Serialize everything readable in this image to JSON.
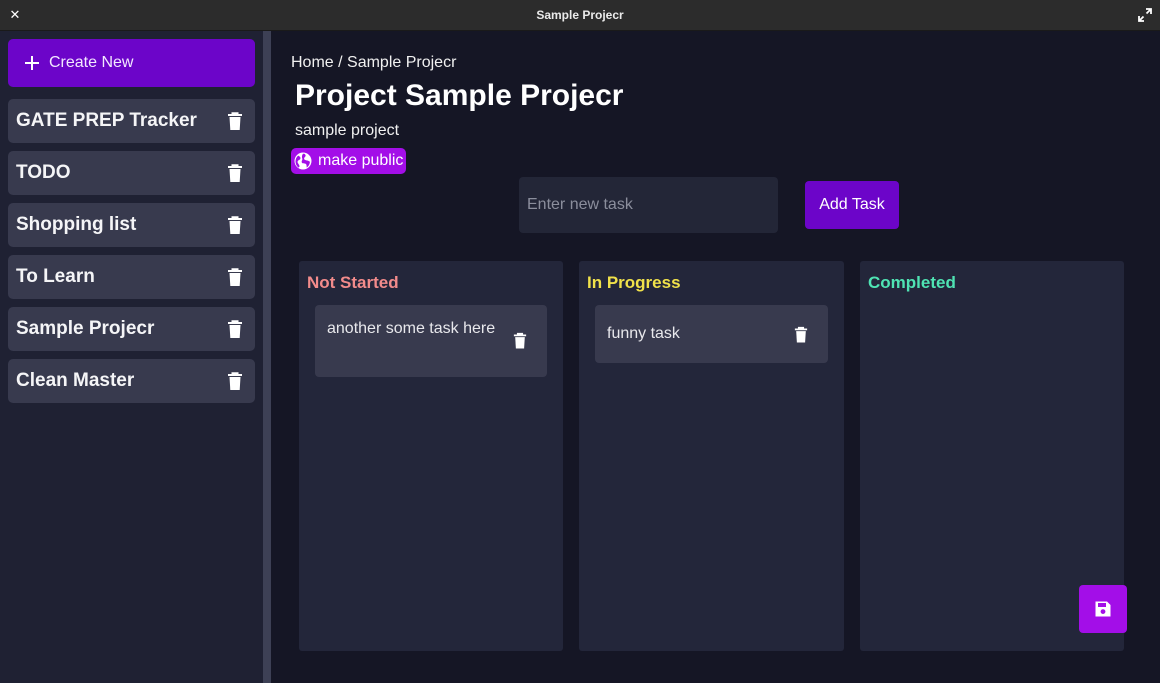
{
  "window": {
    "title": "Sample Projecr"
  },
  "sidebar": {
    "create_label": "Create New",
    "projects": [
      {
        "name": "GATE PREP Tracker"
      },
      {
        "name": "TODO"
      },
      {
        "name": "Shopping list"
      },
      {
        "name": "To Learn"
      },
      {
        "name": "Sample Projecr"
      },
      {
        "name": "Clean Master"
      }
    ]
  },
  "main": {
    "breadcrumb": "Home / Sample Projecr",
    "title": "Project Sample Projecr",
    "description": "sample project",
    "public_label": "make public",
    "task_input": {
      "placeholder": "Enter new task",
      "value": ""
    },
    "add_task_label": "Add Task",
    "columns": [
      {
        "title": "Not Started",
        "color": "#f28b8b",
        "tasks": [
          "another some task here"
        ]
      },
      {
        "title": "In Progress",
        "color": "#f0e14a",
        "tasks": [
          "funny task"
        ]
      },
      {
        "title": "Completed",
        "color": "#4fe3b3",
        "tasks": []
      }
    ]
  },
  "colors": {
    "accent": "#6c05c9",
    "accent_bright": "#a30ee8",
    "sidebar_bg": "#1f2133",
    "main_bg": "#151625"
  },
  "icons": {
    "window_close": "close-icon",
    "window_maximize": "maximize-icon",
    "create": "plus-icon",
    "delete": "trash-icon",
    "public": "globe-icon",
    "save": "floppy-disk-icon"
  }
}
